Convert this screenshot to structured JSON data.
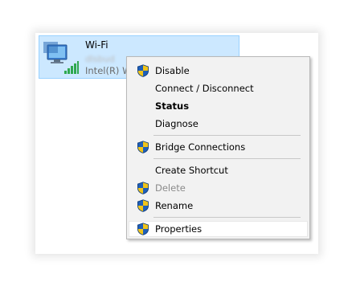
{
  "adapter": {
    "name": "Wi-Fi",
    "status": "dlsbud",
    "device": "Intel(R) W",
    "icon": "wifi-network-adapter-icon"
  },
  "menu": {
    "items": [
      {
        "label": "Disable",
        "shield": true,
        "style": "normal"
      },
      {
        "label": "Connect / Disconnect",
        "shield": false,
        "style": "normal"
      },
      {
        "label": "Status",
        "shield": false,
        "style": "bold"
      },
      {
        "label": "Diagnose",
        "shield": false,
        "style": "normal"
      },
      {
        "label": "Bridge Connections",
        "shield": true,
        "style": "normal"
      },
      {
        "label": "Create Shortcut",
        "shield": false,
        "style": "normal"
      },
      {
        "label": "Delete",
        "shield": true,
        "style": "disabled"
      },
      {
        "label": "Rename",
        "shield": true,
        "style": "normal"
      },
      {
        "label": "Properties",
        "shield": true,
        "style": "hover"
      }
    ]
  },
  "colors": {
    "selection_bg": "#cce8ff",
    "menu_bg": "#f2f2f2",
    "shield_blue": "#1f5fb8",
    "shield_yellow": "#f0c419"
  }
}
